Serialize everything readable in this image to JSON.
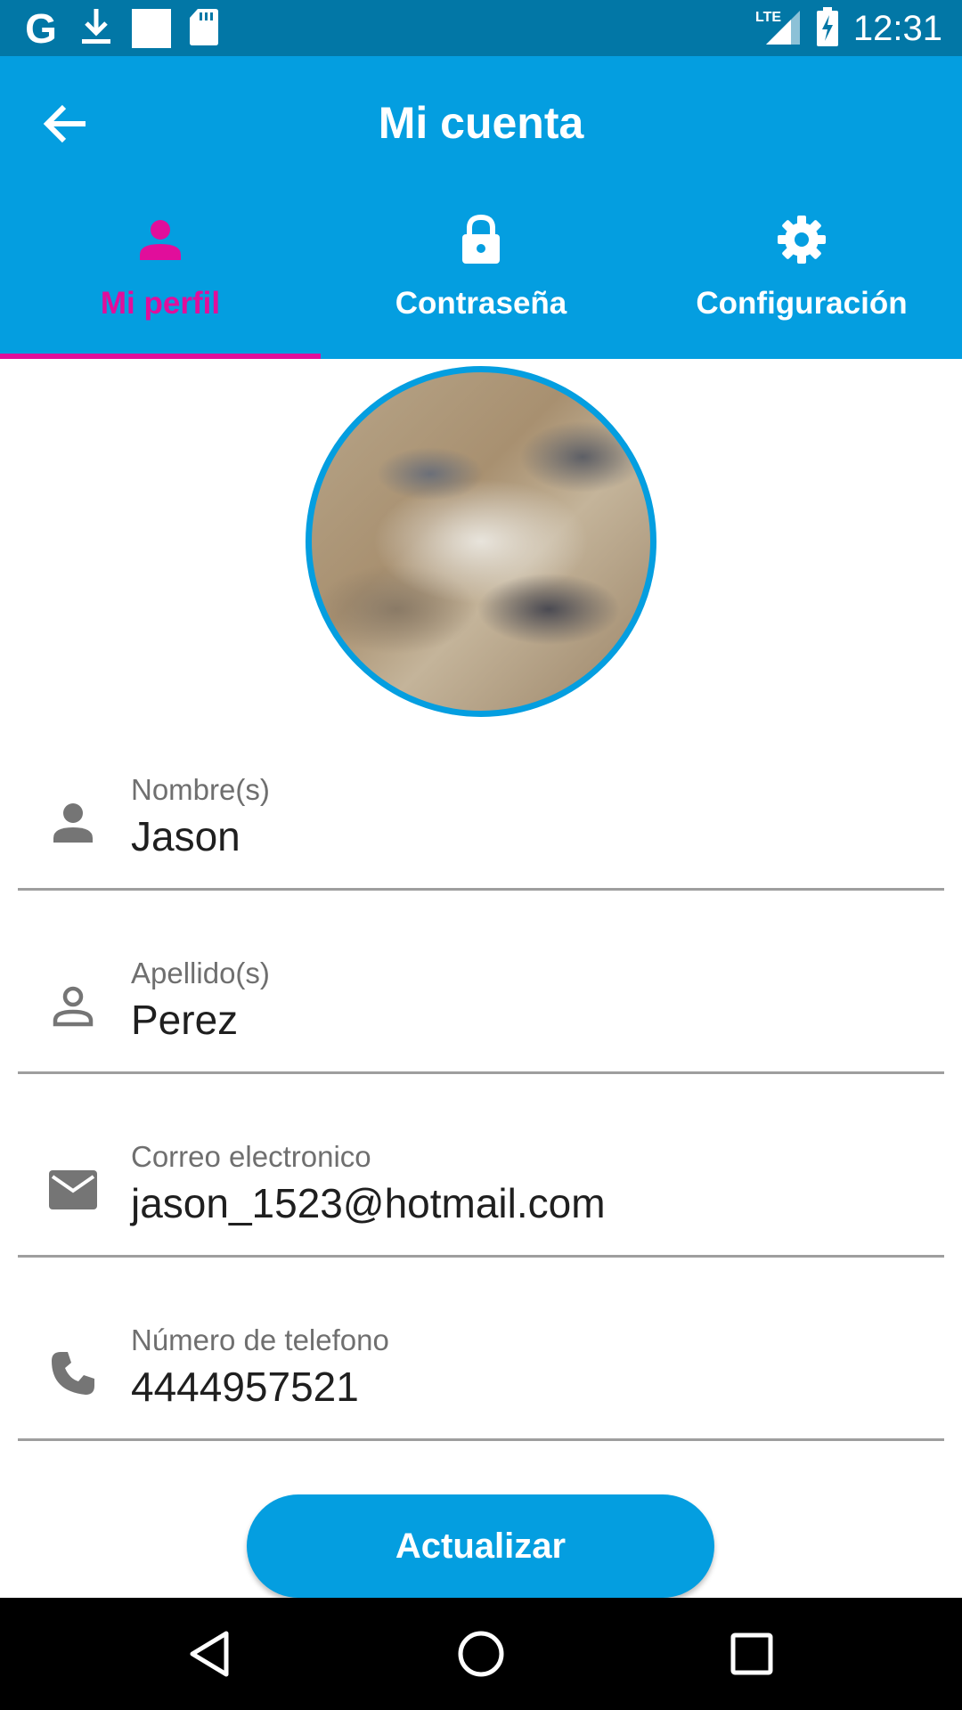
{
  "status_bar": {
    "time": "12:31",
    "network": "LTE",
    "left_icons": [
      "google-icon",
      "download-icon",
      "white-square-icon",
      "sd-card-icon"
    ],
    "right_icons": [
      "signal-icon",
      "battery-charging-icon"
    ]
  },
  "app_bar": {
    "title": "Mi cuenta",
    "back_icon": "arrow-back-icon"
  },
  "tabs": [
    {
      "label": "Mi perfil",
      "icon": "person-icon",
      "active": true
    },
    {
      "label": "Contraseña",
      "icon": "lock-icon",
      "active": false
    },
    {
      "label": "Configuración",
      "icon": "gear-icon",
      "active": false
    }
  ],
  "colors": {
    "primary": "#049ee0",
    "status_bar": "#0277a6",
    "accent": "#e10e9b"
  },
  "profile": {
    "avatar": "marble-texture-photo"
  },
  "form": {
    "fields": [
      {
        "label": "Nombre(s)",
        "value": "Jason",
        "icon": "person-icon"
      },
      {
        "label": "Apellido(s)",
        "value": "Perez",
        "icon": "person-outline-icon"
      },
      {
        "label": "Correo electronico",
        "value": "jason_1523@hotmail.com",
        "icon": "mail-icon"
      },
      {
        "label": "Número de telefono",
        "value": "4444957521",
        "icon": "phone-icon"
      }
    ],
    "submit_label": "Actualizar"
  },
  "nav_bar": {
    "buttons": [
      "back-triangle-icon",
      "home-circle-icon",
      "recents-square-icon"
    ]
  }
}
